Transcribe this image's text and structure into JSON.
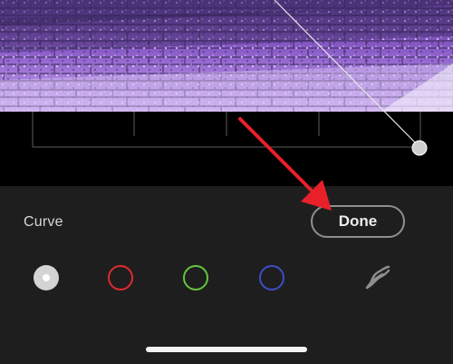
{
  "panel": {
    "title": "Curve",
    "done_label": "Done"
  },
  "channels": [
    {
      "id": "rgb",
      "icon": "rgb-channel-icon",
      "color": "#d4d4d4",
      "selected": true
    },
    {
      "id": "red",
      "icon": "red-channel-icon",
      "color": "#e02a2f",
      "selected": false
    },
    {
      "id": "green",
      "icon": "green-channel-icon",
      "color": "#64c63a",
      "selected": false
    },
    {
      "id": "blue",
      "icon": "blue-channel-icon",
      "color": "#3c4fc7",
      "selected": false
    },
    {
      "id": "parametric",
      "icon": "tone-curve-icon",
      "color": "#8e8e8e",
      "selected": false
    }
  ],
  "annotation": {
    "icon": "pointer-arrow-icon",
    "color": "#e8202a"
  }
}
